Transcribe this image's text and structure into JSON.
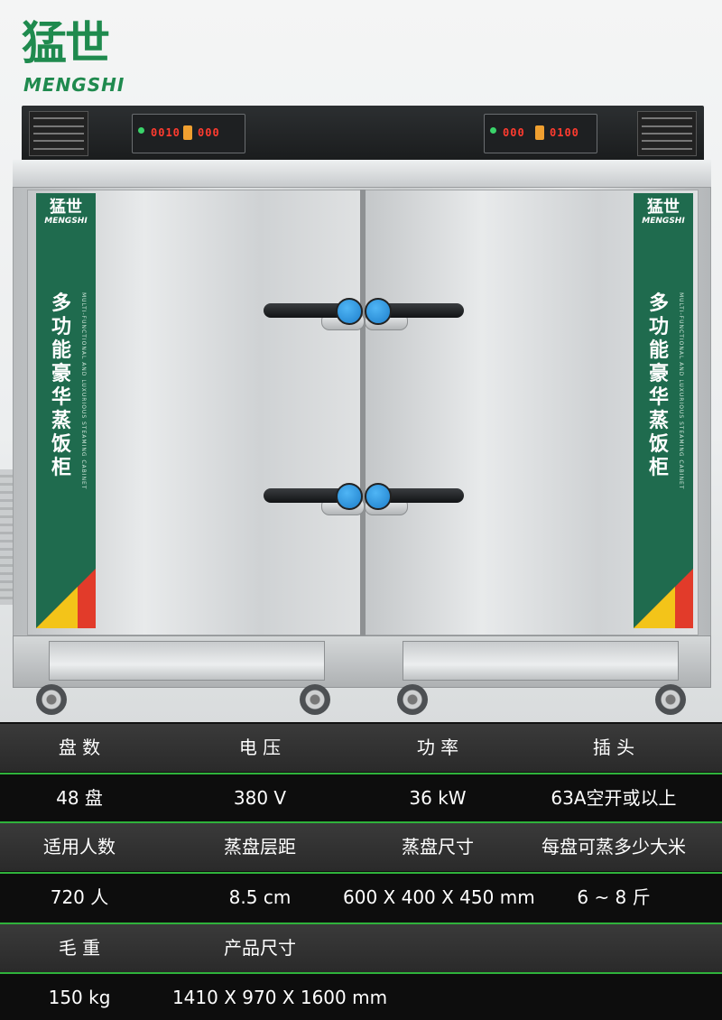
{
  "brand": {
    "logo_cn": "猛世",
    "logo_en": "MENGSHI"
  },
  "product": {
    "side_panel_title": "多功能豪华蒸饭柜",
    "side_panel_subtitle": "MULTI-FUNCTIONAL AND LUXURIOUS STEAMING CABINET",
    "controller_left_display": [
      "0010",
      "000"
    ],
    "controller_right_display": [
      "000",
      "0100"
    ]
  },
  "colors": {
    "brand_green": "#1f8a4e",
    "panel_green": "#1f6b4e",
    "knob_blue": "#2a95e0",
    "divider_green": "#2fb23b"
  },
  "specs": {
    "row1_labels": [
      "盘 数",
      "电 压",
      "功 率",
      "插 头"
    ],
    "row1_values": [
      "48  盘",
      "380  V",
      "36 kW",
      "63A空开或以上"
    ],
    "row2_labels": [
      "适用人数",
      "蒸盘层距",
      "蒸盘尺寸",
      "每盘可蒸多少大米"
    ],
    "row2_values": [
      "720 人",
      "8.5 cm",
      "600 X 400 X 450 mm",
      "6 ~ 8 斤"
    ],
    "row3_labels": [
      "毛 重",
      "产品尺寸"
    ],
    "row3_values": [
      "150 kg",
      "1410 X 970 X 1600 mm"
    ]
  }
}
